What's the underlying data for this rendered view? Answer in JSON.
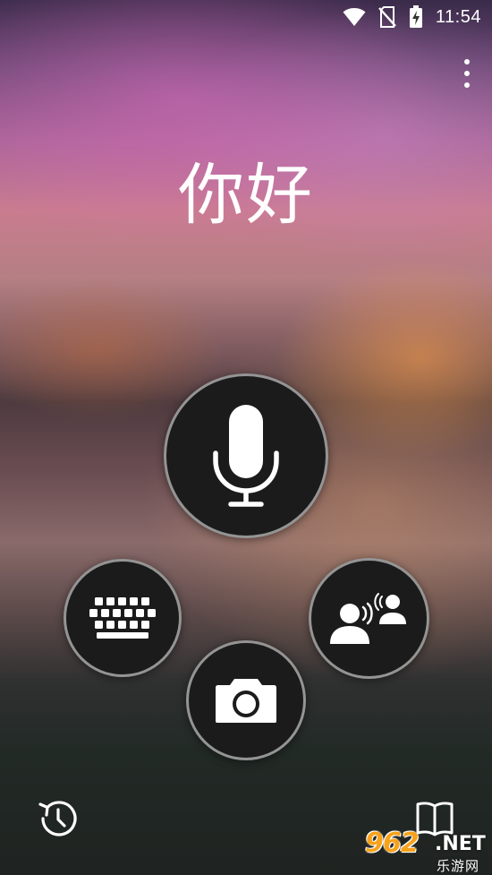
{
  "status_bar": {
    "time": "11:54",
    "icons": [
      "wifi-icon",
      "no-sim-icon",
      "battery-charging-icon"
    ]
  },
  "menu": {
    "icon": "more-vertical-icon"
  },
  "main": {
    "greeting": "你好"
  },
  "actions": {
    "microphone": {
      "icon": "microphone-icon"
    },
    "keyboard": {
      "icon": "keyboard-icon"
    },
    "camera": {
      "icon": "camera-icon"
    },
    "conversation": {
      "icon": "conversation-icon"
    }
  },
  "bottom": {
    "history": {
      "icon": "history-icon"
    },
    "phrasebook": {
      "icon": "book-icon"
    }
  },
  "watermark": {
    "brand": "962",
    "suffix": ".NET",
    "subtitle": "乐游网"
  },
  "colors": {
    "button_fill": "#1b1b1b",
    "button_border": "#bebebe",
    "icon": "#ffffff",
    "watermark_orange": "#f7a21b"
  }
}
